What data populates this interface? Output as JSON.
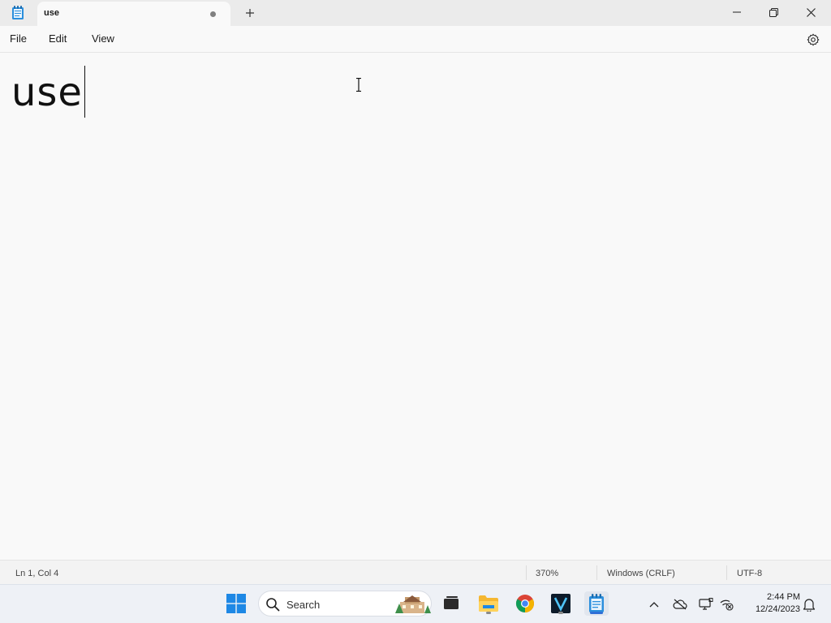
{
  "window": {
    "tab_title": "use",
    "tab_unsaved_indicator": "●",
    "new_tab_icon": "plus-icon",
    "controls": [
      "minimize-icon",
      "restore-icon",
      "close-icon"
    ]
  },
  "menu": {
    "file_label": "File",
    "edit_label": "Edit",
    "view_label": "View",
    "settings_icon": "gear-icon"
  },
  "editor": {
    "content": "use",
    "zoom_percent": 370
  },
  "status": {
    "position": "Ln 1, Col 4",
    "zoom": "370%",
    "line_ending": "Windows (CRLF)",
    "encoding": "UTF-8"
  },
  "taskbar": {
    "search_label": "Search",
    "apps": [
      "windows-start-icon",
      "search-icon",
      "task-view-icon",
      "file-explorer-icon",
      "chrome-icon",
      "v-app-icon",
      "notepad-icon"
    ],
    "tray_icons": [
      "chevron-up-icon",
      "onedrive-offline-icon",
      "display-icon",
      "network-disconnected-icon",
      "notification-bell-icon"
    ],
    "time": "2:44 PM",
    "date": "12/24/2023"
  },
  "colors": {
    "accent": "#2f6fd6",
    "background": "#f9f9f9",
    "titlebar": "#ebebeb",
    "taskbar": "#eef1f6"
  }
}
